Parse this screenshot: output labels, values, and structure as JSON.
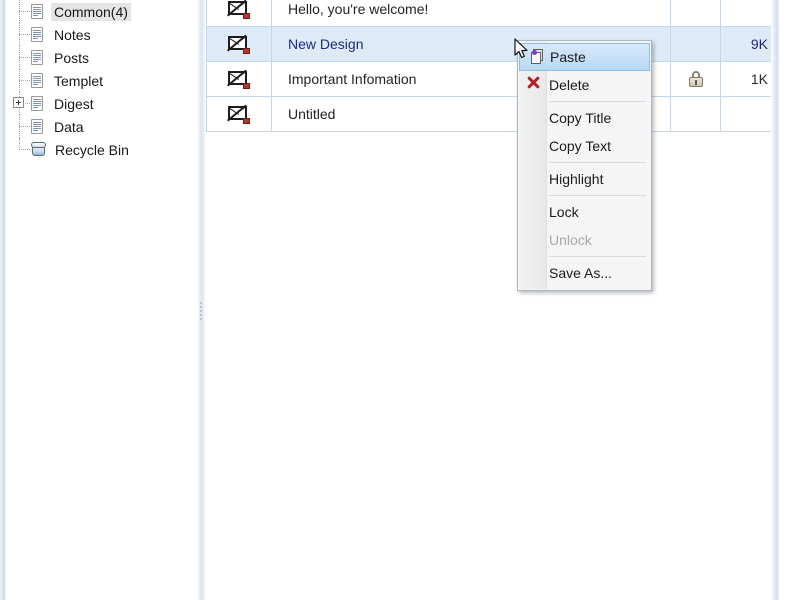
{
  "tree": {
    "items": [
      {
        "label": "Common(4)",
        "icon": "document-icon",
        "selected": true,
        "expandable": false,
        "last": false
      },
      {
        "label": "Notes",
        "icon": "document-icon",
        "selected": false,
        "expandable": false,
        "last": false
      },
      {
        "label": "Posts",
        "icon": "document-icon",
        "selected": false,
        "expandable": false,
        "last": false
      },
      {
        "label": "Templet",
        "icon": "document-icon",
        "selected": false,
        "expandable": false,
        "last": false
      },
      {
        "label": "Digest",
        "icon": "document-icon",
        "selected": false,
        "expandable": true,
        "last": false
      },
      {
        "label": "Data",
        "icon": "document-icon",
        "selected": false,
        "expandable": false,
        "last": false
      },
      {
        "label": "Recycle Bin",
        "icon": "recycle-bin-icon",
        "selected": false,
        "expandable": false,
        "last": true
      }
    ]
  },
  "list": {
    "rows": [
      {
        "icon": "mail-blocked-icon",
        "title": "Hello, you're welcome!",
        "locked": false,
        "size": "",
        "selected": false
      },
      {
        "icon": "mail-blocked-icon",
        "title": "New Design",
        "locked": false,
        "size": "9K",
        "selected": true
      },
      {
        "icon": "mail-blocked-icon",
        "title": "Important Infomation",
        "locked": true,
        "size": "1K",
        "selected": false
      },
      {
        "icon": "mail-blocked-icon",
        "title": "Untitled",
        "locked": false,
        "size": "",
        "selected": false
      }
    ]
  },
  "context_menu": {
    "items": [
      {
        "label": "Paste",
        "glyph": "paste-icon",
        "state": "highlight",
        "separator_after": false
      },
      {
        "label": "Delete",
        "glyph": "delete-icon",
        "state": "normal",
        "separator_after": true
      },
      {
        "label": "Copy Title",
        "glyph": "",
        "state": "normal",
        "separator_after": false
      },
      {
        "label": "Copy Text",
        "glyph": "",
        "state": "normal",
        "separator_after": true
      },
      {
        "label": "Highlight",
        "glyph": "",
        "state": "normal",
        "separator_after": true
      },
      {
        "label": "Lock",
        "glyph": "",
        "state": "normal",
        "separator_after": false
      },
      {
        "label": "Unlock",
        "glyph": "",
        "state": "disabled",
        "separator_after": true
      },
      {
        "label": "Save As...",
        "glyph": "",
        "state": "normal",
        "separator_after": false
      }
    ]
  },
  "colors": {
    "selection_row": "#ddebf8",
    "selection_text": "#1f2a7a",
    "grid_line": "#c3d7ec",
    "menu_highlight": "#b9d8f4",
    "delete_x": "#b61f24"
  }
}
